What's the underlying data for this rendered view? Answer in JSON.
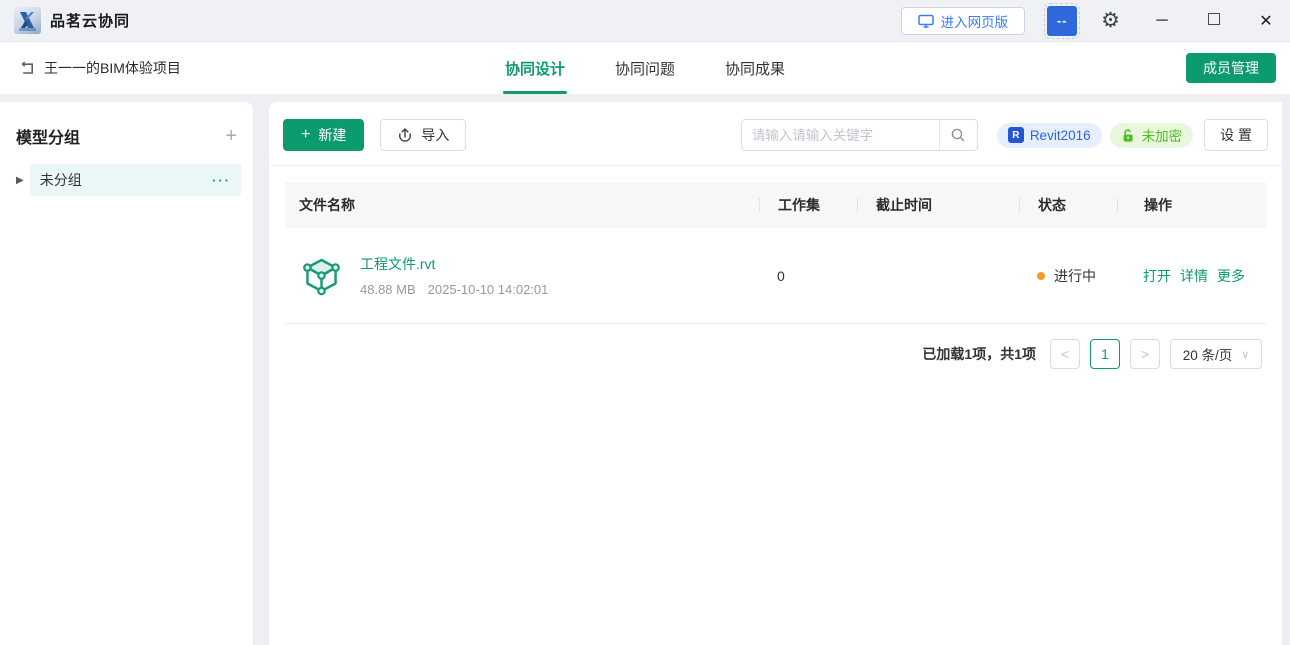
{
  "titlebar": {
    "app_title": "品茗云协同",
    "web_version_button": "进入网页版",
    "avatar_text": "--",
    "window_controls": {
      "minimize": "─",
      "close": "✕"
    }
  },
  "project_bar": {
    "project_name": "王一一的BIM体验项目",
    "tabs": [
      {
        "label": "协同设计",
        "active": true
      },
      {
        "label": "协同问题",
        "active": false
      },
      {
        "label": "协同成果",
        "active": false
      }
    ],
    "member_button": "成员管理"
  },
  "sidebar": {
    "title": "模型分组",
    "add_label": "+",
    "items": [
      {
        "label": "未分组",
        "more": "···"
      }
    ]
  },
  "toolbar": {
    "new_button": "新建",
    "new_plus": "+",
    "import_button": "导入",
    "search_placeholder": "请输入请输入关键字",
    "revit_badge": "Revit2016",
    "revit_icon_letter": "R",
    "encrypt_badge": "未加密",
    "settings_button": "设 置"
  },
  "table": {
    "headers": [
      "文件名称",
      "工作集",
      "截止时间",
      "状态",
      "操作"
    ],
    "rows": [
      {
        "name": "工程文件.rvt",
        "size": "48.88 MB",
        "time": "2025-10-10 14:02:01",
        "workset": "0",
        "deadline": "",
        "status": "进行中",
        "actions": [
          "打开",
          "详情",
          "更多"
        ]
      }
    ]
  },
  "pagination": {
    "summary": "已加载1项，共1项",
    "prev": "<",
    "page": "1",
    "next": ">",
    "page_size": "20 条/页",
    "chevron": "∨"
  },
  "colors": {
    "primary_green": "#0C9B6F",
    "status_orange": "#F59A23",
    "link_blue": "#3B7CFF",
    "revit_blue": "#2E66E0",
    "encrypt_green": "#4FBE1F",
    "titlebar_bg": "#EFF1F4",
    "body_bg": "#EDEFF2"
  }
}
